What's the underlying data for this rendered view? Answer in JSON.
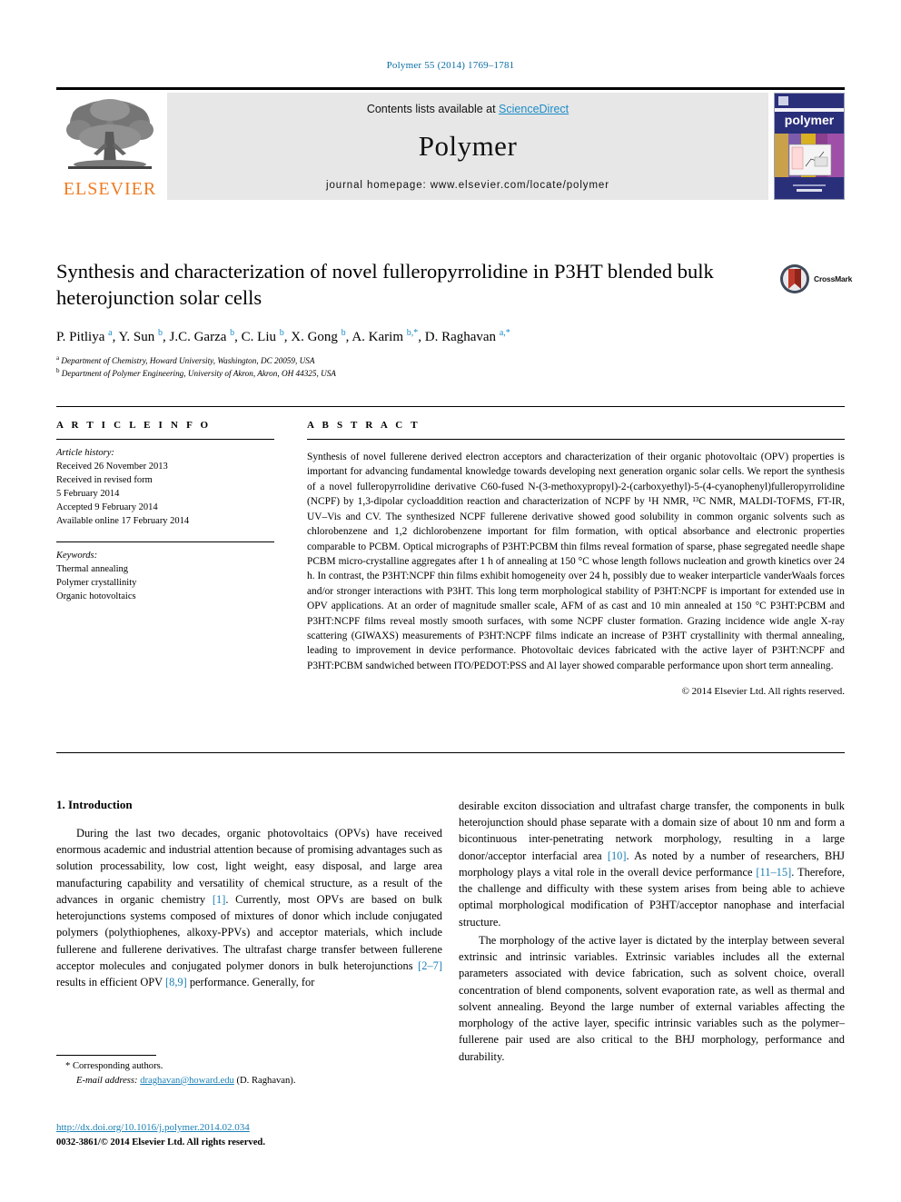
{
  "running_head": "Polymer 55 (2014) 1769–1781",
  "masthead": {
    "publisher_logo_text": "ELSEVIER",
    "contents_prefix": "Contents lists available at ",
    "contents_link": "ScienceDirect",
    "journal_name": "Polymer",
    "homepage_line": "journal homepage: www.elsevier.com/locate/polymer",
    "cover_title": "polymer"
  },
  "article": {
    "title": "Synthesis and characterization of novel fulleropyrrolidine in P3HT blended bulk heterojunction solar cells",
    "authors_html": "P. Pitliya <sup>a</sup>, Y. Sun <sup>b</sup>, J.C. Garza <sup>b</sup>, C. Liu <sup>b</sup>, X. Gong <sup>b</sup>, A. Karim <sup>b,*</sup>, D. Raghavan <sup>a,*</sup>",
    "affiliation_a": "Department of Chemistry, Howard University, Washington, DC 20059, USA",
    "affiliation_b": "Department of Polymer Engineering, University of Akron, Akron, OH 44325, USA",
    "crossmark_label": "CrossMark"
  },
  "article_info": {
    "heading": "A R T I C L E   I N F O",
    "history_label": "Article history:",
    "history": [
      "Received 26 November 2013",
      "Received in revised form",
      "5 February 2014",
      "Accepted 9 February 2014",
      "Available online 17 February 2014"
    ],
    "keywords_label": "Keywords:",
    "keywords": [
      "Thermal annealing",
      "Polymer crystallinity",
      "Organic hotovoltaics"
    ]
  },
  "abstract": {
    "heading": "A B S T R A C T",
    "text": "Synthesis of novel fullerene derived electron acceptors and characterization of their organic photovoltaic (OPV) properties is important for advancing fundamental knowledge towards developing next generation organic solar cells. We report the synthesis of a novel fulleropyrrolidine derivative C60-fused N-(3-methoxypropyl)-2-(carboxyethyl)-5-(4-cyanophenyl)fulleropyrrolidine (NCPF) by 1,3-dipolar cycloaddition reaction and characterization of NCPF by ¹H NMR, ¹³C NMR, MALDI-TOFMS, FT-IR, UV–Vis and CV. The synthesized NCPF fullerene derivative showed good solubility in common organic solvents such as chlorobenzene and 1,2 dichlorobenzene important for film formation, with optical absorbance and electronic properties comparable to PCBM. Optical micrographs of P3HT:PCBM thin films reveal formation of sparse, phase segregated needle shape PCBM micro-crystalline aggregates after 1 h of annealing at 150 °C whose length follows nucleation and growth kinetics over 24 h. In contrast, the P3HT:NCPF thin films exhibit homogeneity over 24 h, possibly due to weaker interparticle vanderWaals forces and/or stronger interactions with P3HT. This long term morphological stability of P3HT:NCPF is important for extended use in OPV applications. At an order of magnitude smaller scale, AFM of as cast and 10 min annealed at 150 °C P3HT:PCBM and P3HT:NCPF films reveal mostly smooth surfaces, with some NCPF cluster formation. Grazing incidence wide angle X-ray scattering (GIWAXS) measurements of P3HT:NCPF films indicate an increase of P3HT crystallinity with thermal annealing, leading to improvement in device performance. Photovoltaic devices fabricated with the active layer of P3HT:NCPF and P3HT:PCBM sandwiched between ITO/PEDOT:PSS and Al layer showed comparable performance upon short term annealing.",
    "copyright": "© 2014 Elsevier Ltd. All rights reserved."
  },
  "body": {
    "section_title": "1. Introduction",
    "left_paragraph_1_a": "During the last two decades, organic photovoltaics (OPVs) have received enormous academic and industrial attention because of promising advantages such as solution processability, low cost, light weight, easy disposal, and large area manufacturing capability and versatility of chemical structure, as a result of the advances in organic chemistry ",
    "ref_1": "[1]",
    "left_paragraph_1_b": ". Currently, most OPVs are based on bulk heterojunctions systems composed of mixtures of donor which include conjugated polymers (polythiophenes, alkoxy-PPVs) and acceptor materials, which include fullerene and fullerene derivatives. The ultrafast charge transfer between fullerene acceptor molecules and conjugated polymer donors in bulk heterojunctions ",
    "ref_2_7": "[2–7]",
    "left_paragraph_1_c": " results in efficient OPV ",
    "ref_8_9": "[8,9]",
    "left_paragraph_1_d": " performance. Generally, for",
    "right_paragraph_1_a": "desirable exciton dissociation and ultrafast charge transfer, the components in bulk heterojunction should phase separate with a domain size of about 10 nm and form a bicontinuous inter-penetrating network morphology, resulting in a large donor/acceptor interfacial area ",
    "ref_10": "[10]",
    "right_paragraph_1_b": ". As noted by a number of researchers, BHJ morphology plays a vital role in the overall device performance ",
    "ref_11_15": "[11–15]",
    "right_paragraph_1_c": ". Therefore, the challenge and difficulty with these system arises from being able to achieve optimal morphological modification of P3HT/acceptor nanophase and interfacial structure.",
    "right_paragraph_2": "The morphology of the active layer is dictated by the interplay between several extrinsic and intrinsic variables. Extrinsic variables includes all the external parameters associated with device fabrication, such as solvent choice, overall concentration of blend components, solvent evaporation rate, as well as thermal and solvent annealing. Beyond the large number of external variables affecting the morphology of the active layer, specific intrinsic variables such as the polymer–fullerene pair used are also critical to the BHJ morphology, performance and durability."
  },
  "footnotes": {
    "corresponding": "* Corresponding authors.",
    "email_label": "E-mail address:",
    "email": "draghavan@howard.edu",
    "email_suffix": " (D. Raghavan).",
    "doi": "http://dx.doi.org/10.1016/j.polymer.2014.02.034",
    "issn_line": "0032-3861/© 2014 Elsevier Ltd. All rights reserved."
  },
  "colors": {
    "link_blue": "#1a7fb5",
    "elsevier_orange": "#f07c22",
    "cover_navy": "#2a2f7a",
    "band_gray": "#e7e7e7"
  }
}
